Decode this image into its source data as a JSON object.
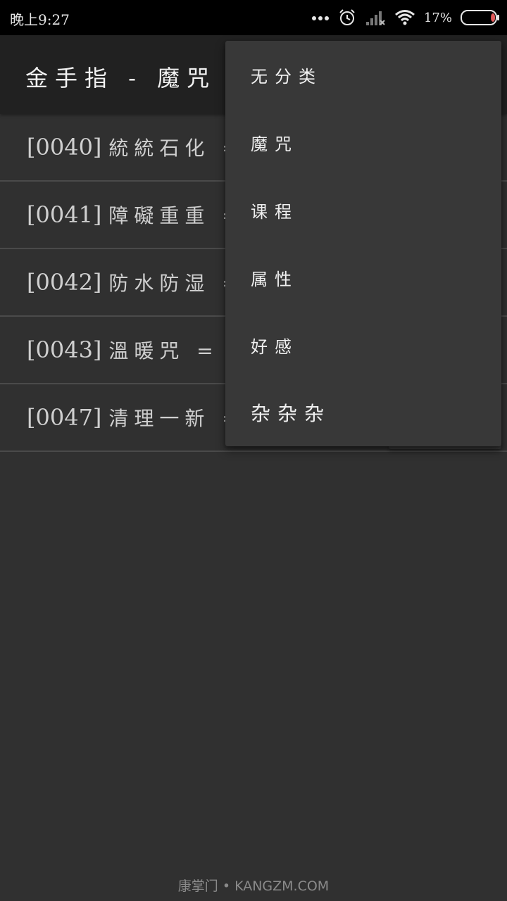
{
  "status_bar": {
    "time": "晚上9:27",
    "battery_percent": "17%",
    "battery_level": 0.17,
    "icons": [
      "more-dots-icon",
      "alarm-clock-icon",
      "signal-icon",
      "wifi-icon",
      "battery-icon"
    ]
  },
  "app_bar": {
    "title": "金手指 - 魔咒"
  },
  "list": {
    "items": [
      {
        "code": "[0040]",
        "name": "統統石化 ="
      },
      {
        "code": "[0041]",
        "name": "障礙重重 ="
      },
      {
        "code": "[0042]",
        "name": "防水防湿 ="
      },
      {
        "code": "[0043]",
        "name": "溫暖咒 = 0"
      },
      {
        "code": "[0047]",
        "name": "清理一新 ="
      }
    ]
  },
  "menu": {
    "items": [
      {
        "label": "无分类"
      },
      {
        "label": "魔咒"
      },
      {
        "label": "课程"
      },
      {
        "label": "属性"
      },
      {
        "label": "好感"
      },
      {
        "label": "杂杂杂"
      }
    ]
  },
  "watermark": "康掌门 • KANGZM.COM",
  "colors": {
    "background": "#303030",
    "app_bar": "#212121",
    "menu": "#383838",
    "battery_fill": "#e05a5a"
  }
}
